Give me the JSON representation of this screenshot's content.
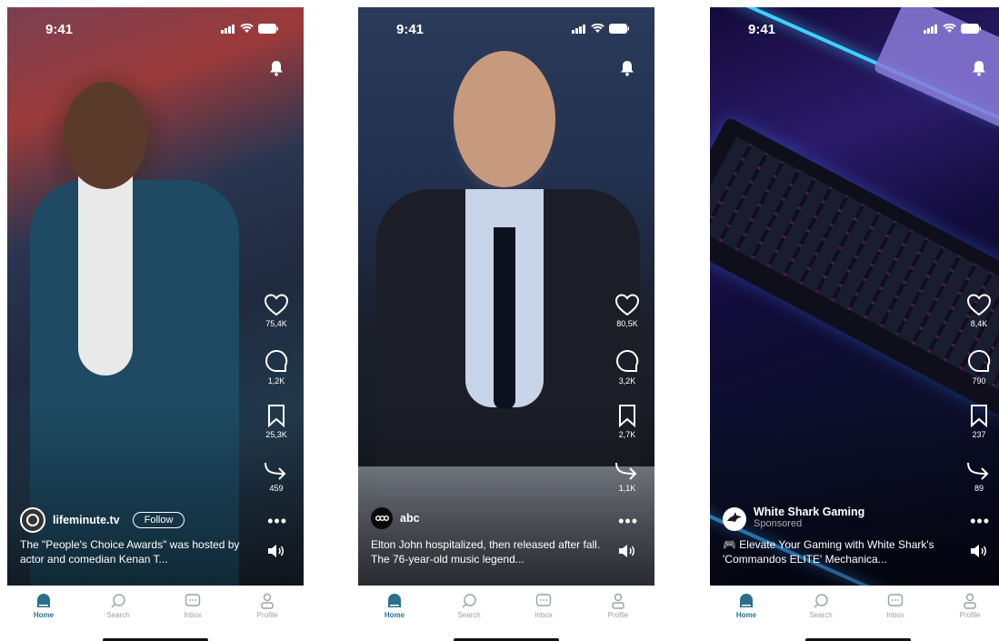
{
  "status_time": "9:41",
  "tabs": [
    {
      "label": "Home",
      "icon": "home-icon"
    },
    {
      "label": "Search",
      "icon": "search-icon"
    },
    {
      "label": "Inbox",
      "icon": "inbox-icon"
    },
    {
      "label": "Profile",
      "icon": "profile-icon"
    }
  ],
  "colors": {
    "active_tab": "#2b6f8e",
    "inactive_tab": "#9aa0a6"
  },
  "phones": [
    {
      "author": "lifeminute.tv",
      "follow_label": "Follow",
      "caption": "The \"People's Choice Awards\" was hosted by actor and comedian Kenan T...",
      "likes": "75,4K",
      "comments": "1,2K",
      "saves": "25,3K",
      "shares": "459"
    },
    {
      "author": "abc",
      "caption": "Elton John hospitalized, then released after fall. The 76-year-old music legend...",
      "likes": "80,5K",
      "comments": "3,2K",
      "saves": "2,7K",
      "shares": "1,1K"
    },
    {
      "author": "White Shark Gaming",
      "sponsored_label": "Sponsored",
      "caption": "🎮 Elevate Your Gaming with White Shark's 'Commandos ELITE' Mechanica...",
      "likes": "8,4K",
      "comments": "790",
      "saves": "237",
      "shares": "89"
    }
  ]
}
